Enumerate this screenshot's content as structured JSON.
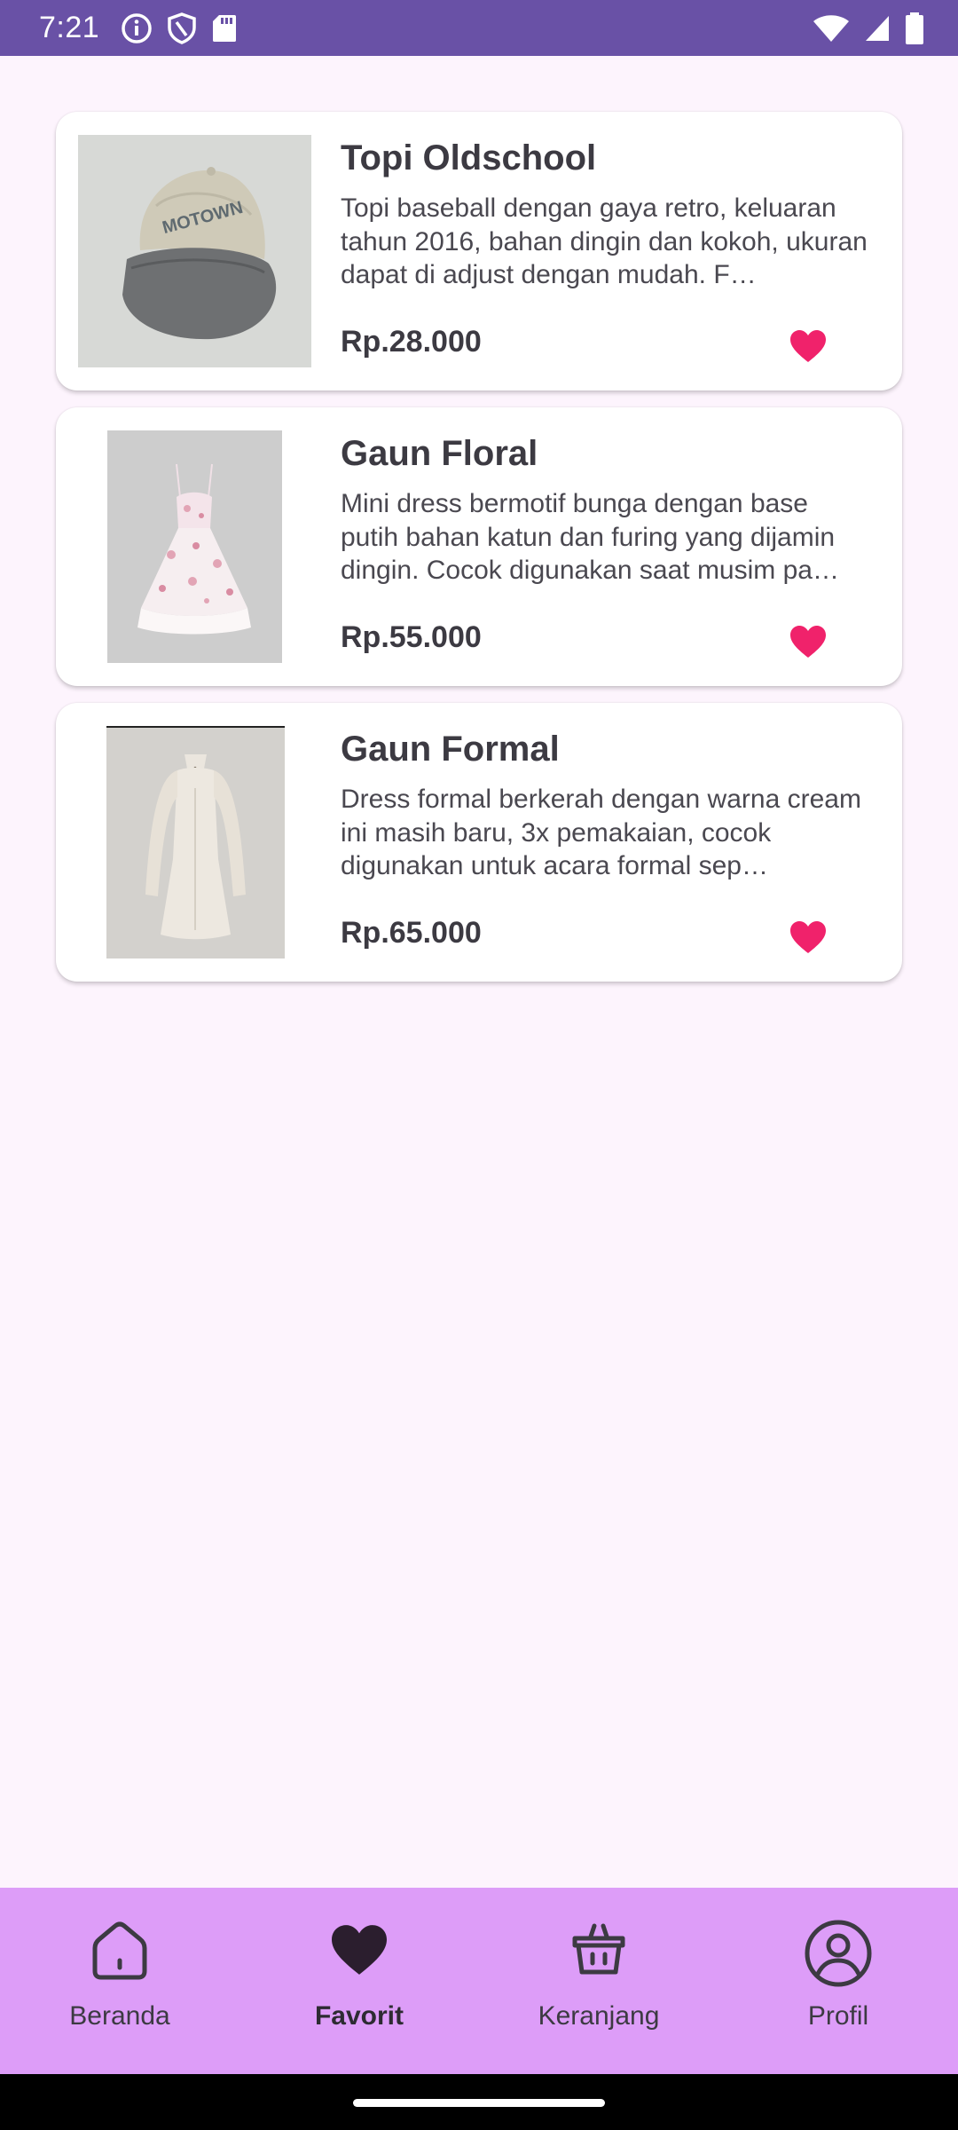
{
  "status_bar": {
    "time": "7:21",
    "icons": [
      "info-icon",
      "shield-icon",
      "sd-card-icon",
      "wifi-icon",
      "signal-icon",
      "battery-icon"
    ]
  },
  "favorites": [
    {
      "title": "Topi Oldschool",
      "description": "Topi baseball dengan gaya retro, keluaran tahun 2016, bahan dingin dan kokoh, ukuran dapat di adjust dengan mudah. F…",
      "price": "Rp.28.000",
      "image": "baseball-cap-photo",
      "favorited": true
    },
    {
      "title": "Gaun Floral",
      "description": "Mini dress bermotif bunga dengan base putih bahan katun dan furing yang dijamin dingin. Cocok digunakan saat musim pa…",
      "price": "Rp.55.000",
      "image": "floral-dress-photo",
      "favorited": true
    },
    {
      "title": "Gaun Formal",
      "description": "Dress formal berkerah dengan warna cream ini masih baru, 3x pemakaian, cocok digunakan untuk acara formal sep…",
      "price": "Rp.65.000",
      "image": "formal-dress-photo",
      "favorited": true
    }
  ],
  "bottom_nav": {
    "items": [
      {
        "label": "Beranda",
        "icon": "home-icon",
        "active": false
      },
      {
        "label": "Favorit",
        "icon": "heart-icon",
        "active": true
      },
      {
        "label": "Keranjang",
        "icon": "basket-icon",
        "active": false
      },
      {
        "label": "Profil",
        "icon": "profile-icon",
        "active": false
      }
    ]
  },
  "colors": {
    "status_bar": "#6951a6",
    "background": "#fdf4fd",
    "bottom_nav": "#dd9df8",
    "heart": "#f0226b",
    "text_dark": "#3c3a42"
  }
}
